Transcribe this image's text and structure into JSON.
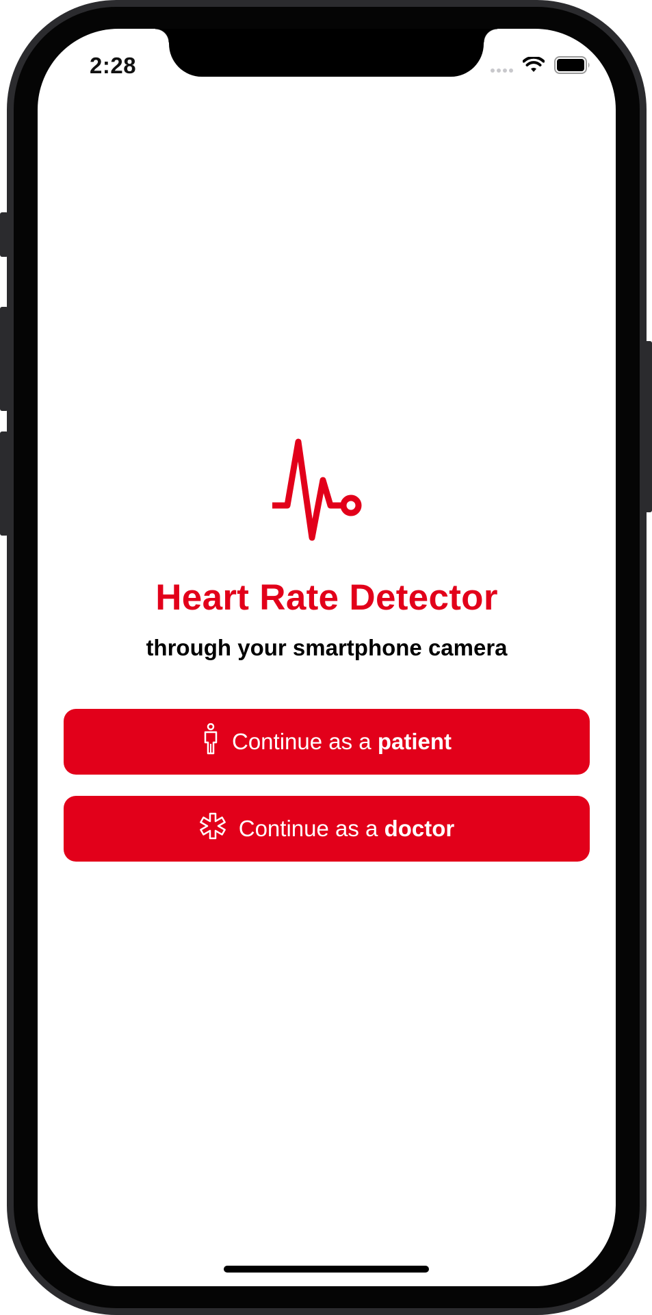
{
  "status_bar": {
    "time": "2:28",
    "icons": [
      "cellular-signal-icon",
      "wifi-icon",
      "battery-icon"
    ]
  },
  "app": {
    "logo_icon": "heart-rate-pulse-icon",
    "title": "Heart Rate Detector",
    "subtitle": "through your smartphone camera"
  },
  "buttons": {
    "patient": {
      "icon": "person-icon",
      "prefix": "Continue as a ",
      "emphasis": "patient"
    },
    "doctor": {
      "icon": "medical-star-icon",
      "prefix": "Continue as a ",
      "emphasis": "doctor"
    }
  },
  "colors": {
    "accent": "#e2001a",
    "background": "#ffffff",
    "text": "#000000"
  }
}
